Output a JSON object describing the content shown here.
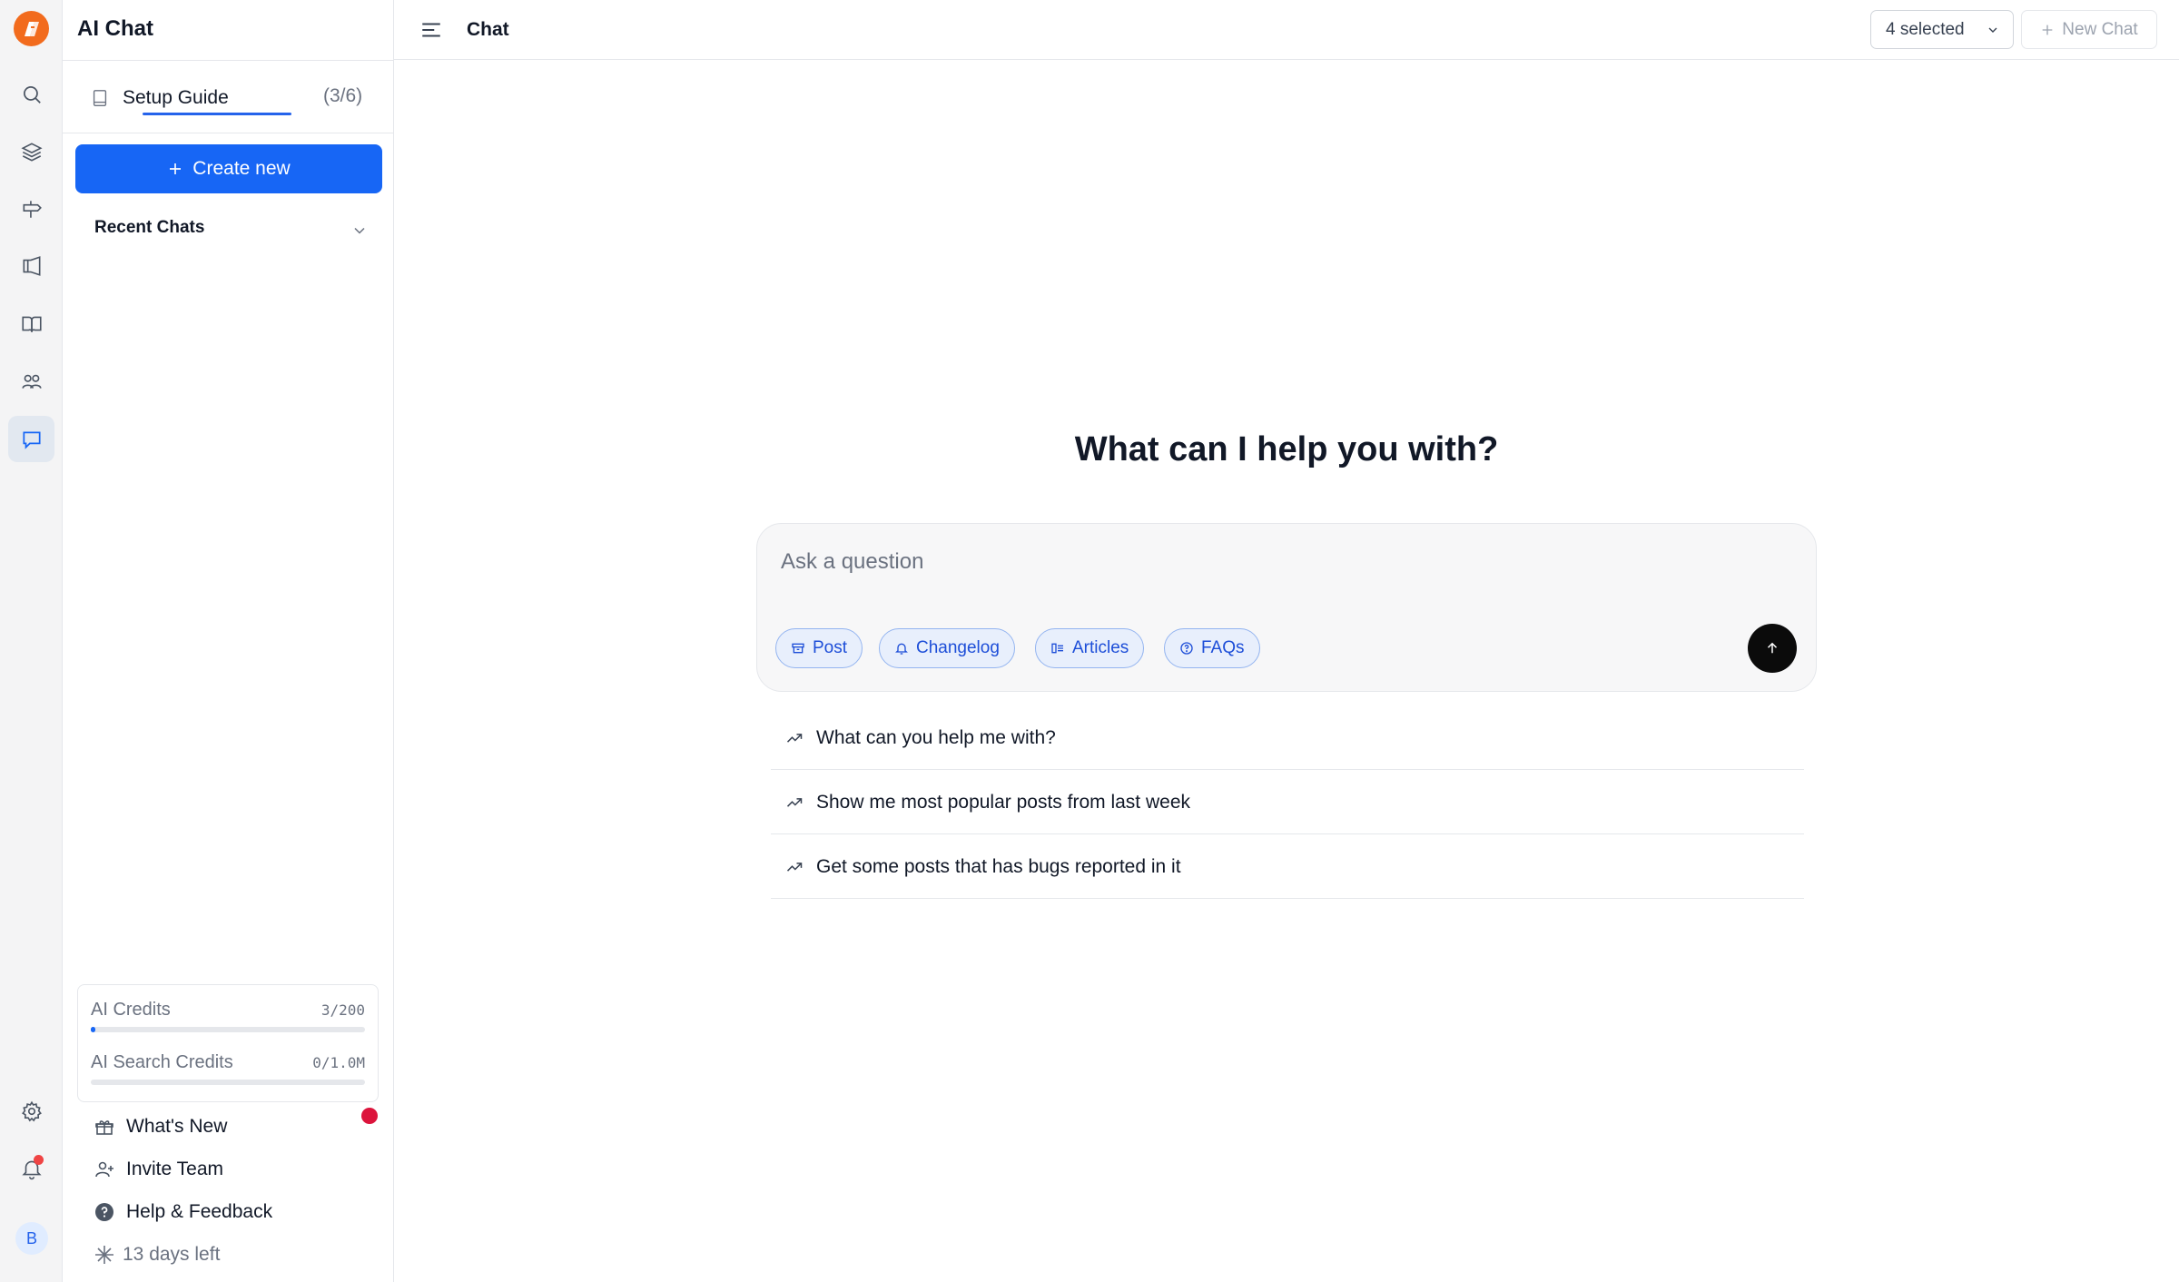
{
  "rail": {
    "icons": [
      "logo-icon",
      "search-icon",
      "layers-icon",
      "signpost-icon",
      "megaphone-icon",
      "book-open-icon",
      "users-icon",
      "chat-icon",
      "gear-icon",
      "bell-icon"
    ],
    "active": "chat-icon",
    "avatar_initial": "B"
  },
  "panel": {
    "title": "AI Chat",
    "setup_guide": {
      "label": "Setup Guide",
      "count": "(3/6)"
    },
    "create_label": "Create new",
    "recent_label": "Recent Chats",
    "credits": [
      {
        "name": "AI Credits",
        "value": "3/200",
        "fraction": 0.015
      },
      {
        "name": "AI Search Credits",
        "value": "0/1.0M",
        "fraction": 0
      }
    ],
    "links": {
      "whats_new": "What's New",
      "invite": "Invite Team",
      "help": "Help & Feedback",
      "trial": "13 days left"
    }
  },
  "topbar": {
    "title": "Chat",
    "selector_label": "4 selected",
    "new_chat_label": "New Chat"
  },
  "main": {
    "headline": "What can I help you with?",
    "input_placeholder": "Ask a question",
    "chips": [
      "Post",
      "Changelog",
      "Articles",
      "FAQs"
    ],
    "suggestions": [
      "What can you help me with?",
      "Show me most popular posts from last week",
      "Get some posts that has bugs reported in it"
    ]
  },
  "colors": {
    "accent": "#1766f5",
    "logo": "#f26b1d",
    "notification": "#dc143c"
  }
}
